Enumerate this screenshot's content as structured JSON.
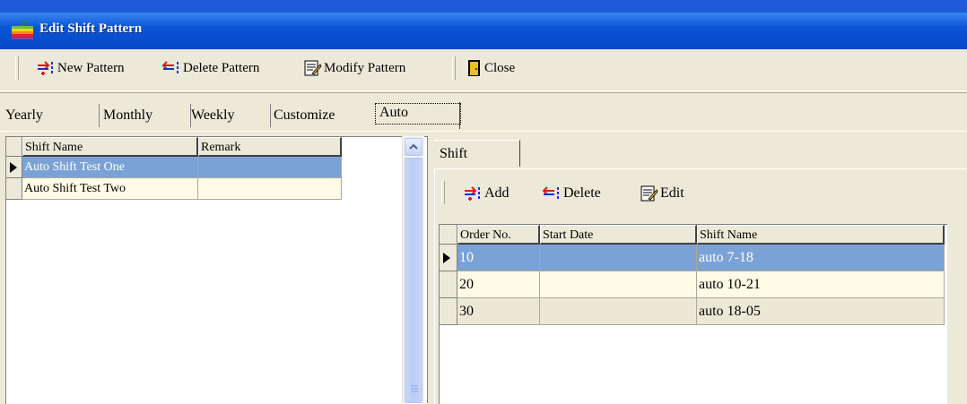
{
  "window": {
    "title": "Edit Shift Pattern"
  },
  "toolbar": {
    "new_pattern": "New Pattern",
    "delete_pattern": "Delete Pattern",
    "modify_pattern": "Modify Pattern",
    "close": "Close"
  },
  "tabs": [
    "Yearly",
    "Monthly",
    "Weekly",
    "Customize",
    "Auto"
  ],
  "active_tab": "Auto",
  "pattern_grid": {
    "headers": [
      "Shift Name",
      "Remark"
    ],
    "rows": [
      {
        "name": "Auto Shift Test One",
        "remark": ""
      },
      {
        "name": "Auto Shift Test Two",
        "remark": ""
      }
    ]
  },
  "right_panel": {
    "tab": "Shift",
    "add": "Add",
    "delete": "Delete",
    "edit": "Edit"
  },
  "shift_grid": {
    "headers": [
      "Order No.",
      "Start Date",
      "Shift Name"
    ],
    "rows": [
      {
        "order": "10",
        "start": "",
        "shift": "auto 7-18"
      },
      {
        "order": "20",
        "start": "",
        "shift": "auto 10-21"
      },
      {
        "order": "30",
        "start": "",
        "shift": "auto 18-05"
      }
    ]
  },
  "colors": {
    "title_blue": "#0a55d8",
    "selected_row": "#7ba2d6",
    "row_light": "#fffbe6",
    "row_alt": "#ebe9d6"
  }
}
